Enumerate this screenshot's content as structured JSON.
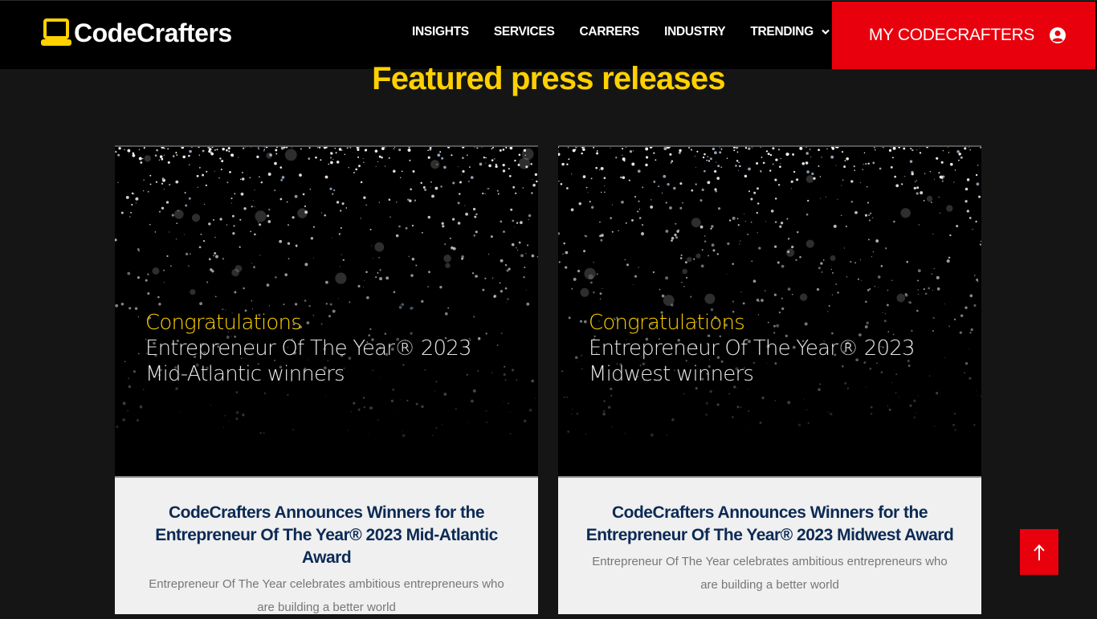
{
  "header": {
    "logo_prefix": "",
    "logo_text": "CodeCrafters",
    "nav": [
      {
        "label": "INSIGHTS"
      },
      {
        "label": "SERVICES"
      },
      {
        "label": "CARRERS"
      },
      {
        "label": "INDUSTRY"
      },
      {
        "label": "TRENDING",
        "has_dropdown": true,
        "icon": "chevron-down-icon"
      }
    ],
    "account_button": {
      "label": "MY CODECRAFTERS",
      "icon": "user-circle-icon"
    }
  },
  "main": {
    "heading": "Featured press releases",
    "cards": [
      {
        "image": {
          "congrats": "Congratulations",
          "line1": "Entrepreneur Of The Year® 2023",
          "line2": "Mid-Atlantic winners"
        },
        "title_line1": "CodeCrafters Announces Winners for the",
        "title_line2": "Entrepreneur Of The Year® 2023 Mid-Atlantic Award",
        "description": "Entrepreneur Of The Year celebrates ambitious entrepreneurs who are building a better world"
      },
      {
        "image": {
          "congrats": "Congratulations",
          "line1": "Entrepreneur Of The Year® 2023",
          "line2": "Midwest winners"
        },
        "title_line1": "CodeCrafters Announces Winners for the",
        "title_line2": "Entrepreneur Of The Year® 2023 Midwest Award",
        "description": "Entrepreneur Of The Year celebrates ambitious entrepreneurs who are building a better world"
      }
    ]
  },
  "back_to_top": {
    "icon": "arrow-up-icon"
  },
  "colors": {
    "accent_yellow": "#ffd100",
    "accent_red": "#e8000d",
    "background": "#151515",
    "title_navy": "#0c2a55"
  }
}
